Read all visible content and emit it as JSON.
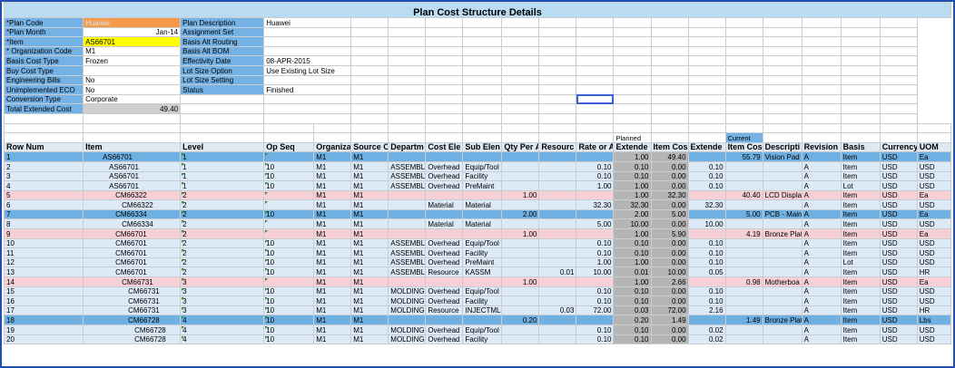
{
  "title": "Plan Cost Structure Details",
  "left_fields": [
    {
      "label": "*Plan Code",
      "value": "Huawei",
      "style": "orange"
    },
    {
      "label": "*Plan Month",
      "value": "Jan-14",
      "style": "right"
    },
    {
      "label": "*Item",
      "value": "AS66701",
      "style": "yellow"
    },
    {
      "label": "* Organization Code",
      "value": "M1",
      "style": "plain"
    },
    {
      "label": "Basis Cost Type",
      "value": "Frozen",
      "style": "plain"
    },
    {
      "label": "Buy Cost Type",
      "value": "",
      "style": "plain"
    },
    {
      "label": "Engineering Bills",
      "value": "No",
      "style": "plain"
    },
    {
      "label": "Unimplemented ECO",
      "value": "No",
      "style": "plain"
    },
    {
      "label": "Conversion Type",
      "value": "Corporate",
      "style": "plain"
    },
    {
      "label": "Total Extended Cost",
      "value": "49.40",
      "style": "gray"
    }
  ],
  "right_fields": [
    {
      "label": "Plan Description",
      "value": "Huawei"
    },
    {
      "label": "Assignment Set",
      "value": ""
    },
    {
      "label": "Basis Alt Routing",
      "value": ""
    },
    {
      "label": "Basis Alt BOM",
      "value": ""
    },
    {
      "label": "Effectivity Date",
      "value": "08-APR-2015"
    },
    {
      "label": "Lot Size Option",
      "value": "Use Existing Lot Size"
    },
    {
      "label": "Lot Size Setting",
      "value": ""
    },
    {
      "label": "Status",
      "value": "Finished"
    }
  ],
  "group_labels": {
    "planned": "Planned",
    "current": "Current"
  },
  "columns": [
    "Row Num",
    "Item",
    "Level",
    "Op Seq",
    "Organiza",
    "Source C",
    "Departm",
    "Cost Ele",
    "Sub Elen",
    "Qty Per A",
    "Resourc",
    "Rate or A",
    "Extende",
    "Item Cos",
    "Extende",
    "Item Cos",
    "Descripti",
    "Revision",
    "Basis",
    "Currency",
    "UOM"
  ],
  "rows": [
    {
      "type": "dblue",
      "c": [
        "1",
        "AS66701",
        "1",
        "",
        "M1",
        "M1",
        "",
        "",
        "",
        "",
        "",
        "",
        "1.00",
        "49.40",
        "",
        "55.79",
        "Vision Pad",
        "A",
        "Item",
        "USD",
        "Ea"
      ],
      "ind": 3
    },
    {
      "type": "lblue",
      "c": [
        "2",
        "AS66701",
        "1",
        "10",
        "M1",
        "M1",
        "ASSEMBLY",
        "Overhead",
        "Equip/Tool",
        "",
        "",
        "0.10",
        "0.10",
        "0.00",
        "0.10",
        "",
        "",
        "A",
        "Item",
        "USD",
        "USD"
      ],
      "ind": 4
    },
    {
      "type": "lblue",
      "c": [
        "3",
        "AS66701",
        "1",
        "10",
        "M1",
        "M1",
        "ASSEMBLY",
        "Overhead",
        "Facility",
        "",
        "",
        "0.10",
        "0.10",
        "0.00",
        "0.10",
        "",
        "",
        "A",
        "Item",
        "USD",
        "USD"
      ],
      "ind": 4
    },
    {
      "type": "lblue",
      "c": [
        "4",
        "AS66701",
        "1",
        "10",
        "M1",
        "M1",
        "ASSEMBLY",
        "Overhead",
        "PreMaint",
        "",
        "",
        "1.00",
        "1.00",
        "0.00",
        "0.10",
        "",
        "",
        "A",
        "Lot",
        "USD",
        "USD"
      ],
      "ind": 4
    },
    {
      "type": "pink",
      "c": [
        "5",
        "CM66322",
        "2",
        "",
        "M1",
        "M1",
        "",
        "",
        "",
        "1.00",
        "",
        "",
        "1.00",
        "32.30",
        "",
        "40.40",
        "LCD Display",
        "A",
        "Item",
        "USD",
        "Ea"
      ],
      "ind": 5
    },
    {
      "type": "lblue",
      "c": [
        "6",
        "CM66322",
        "2",
        "",
        "M1",
        "M1",
        "",
        "Material",
        "Material",
        "",
        "",
        "32.30",
        "32.30",
        "0.00",
        "32.30",
        "",
        "",
        "A",
        "Item",
        "USD",
        "USD"
      ],
      "ind": 6
    },
    {
      "type": "dblue",
      "c": [
        "7",
        "CM66334",
        "2",
        "10",
        "M1",
        "M1",
        "",
        "",
        "",
        "2.00",
        "",
        "",
        "2.00",
        "5.00",
        "",
        "5.00",
        "PCB - Main",
        "A",
        "Item",
        "USD",
        "Ea"
      ],
      "ind": 5
    },
    {
      "type": "lblue",
      "c": [
        "8",
        "CM66334",
        "2",
        "",
        "M1",
        "M1",
        "",
        "Material",
        "Material",
        "",
        "",
        "5.00",
        "10.00",
        "0.00",
        "10.00",
        "",
        "",
        "A",
        "Item",
        "USD",
        "USD"
      ],
      "ind": 6
    },
    {
      "type": "pink",
      "c": [
        "9",
        "CM66701",
        "2",
        "",
        "M1",
        "M1",
        "",
        "",
        "",
        "1.00",
        "",
        "",
        "1.00",
        "5.90",
        "",
        "4.19",
        "Bronze Plat",
        "A",
        "Item",
        "USD",
        "Ea"
      ],
      "ind": 5
    },
    {
      "type": "lblue",
      "c": [
        "10",
        "CM66701",
        "2",
        "10",
        "M1",
        "M1",
        "ASSEMBLY",
        "Overhead",
        "Equip/Tool",
        "",
        "",
        "0.10",
        "0.10",
        "0.00",
        "0.10",
        "",
        "",
        "A",
        "Item",
        "USD",
        "USD"
      ],
      "ind": 5
    },
    {
      "type": "lblue",
      "c": [
        "11",
        "CM66701",
        "2",
        "10",
        "M1",
        "M1",
        "ASSEMBLY",
        "Overhead",
        "Facility",
        "",
        "",
        "0.10",
        "0.10",
        "0.00",
        "0.10",
        "",
        "",
        "A",
        "Item",
        "USD",
        "USD"
      ],
      "ind": 5
    },
    {
      "type": "lblue",
      "c": [
        "12",
        "CM66701",
        "2",
        "10",
        "M1",
        "M1",
        "ASSEMBLY",
        "Overhead",
        "PreMaint",
        "",
        "",
        "1.00",
        "1.00",
        "0.00",
        "0.10",
        "",
        "",
        "A",
        "Lot",
        "USD",
        "USD"
      ],
      "ind": 5
    },
    {
      "type": "lblue",
      "c": [
        "13",
        "CM66701",
        "2",
        "10",
        "M1",
        "M1",
        "ASSEMBLY",
        "Resource",
        "KASSM",
        "",
        "0.01",
        "10.00",
        "0.01",
        "10.00",
        "0.05",
        "",
        "",
        "A",
        "Item",
        "USD",
        "HR"
      ],
      "ind": 5
    },
    {
      "type": "pink",
      "c": [
        "14",
        "CM66731",
        "3",
        "",
        "M1",
        "M1",
        "",
        "",
        "",
        "1.00",
        "",
        "",
        "1.00",
        "2.66",
        "",
        "0.98",
        "Motherboa",
        "A",
        "Item",
        "USD",
        "Ea"
      ],
      "ind": 6
    },
    {
      "type": "lblue",
      "c": [
        "15",
        "CM66731",
        "3",
        "10",
        "M1",
        "M1",
        "MOLDING",
        "Overhead",
        "Equip/Tool",
        "",
        "",
        "0.10",
        "0.10",
        "0.00",
        "0.10",
        "",
        "",
        "A",
        "Item",
        "USD",
        "USD"
      ],
      "ind": 7
    },
    {
      "type": "lblue",
      "c": [
        "16",
        "CM66731",
        "3",
        "10",
        "M1",
        "M1",
        "MOLDING",
        "Overhead",
        "Facility",
        "",
        "",
        "0.10",
        "0.10",
        "0.00",
        "0.10",
        "",
        "",
        "A",
        "Item",
        "USD",
        "USD"
      ],
      "ind": 7
    },
    {
      "type": "lblue",
      "c": [
        "17",
        "CM66731",
        "3",
        "10",
        "M1",
        "M1",
        "MOLDING",
        "Resource",
        "INJECTMLD3",
        "",
        "0.03",
        "72.00",
        "0.03",
        "72.00",
        "2.16",
        "",
        "",
        "A",
        "Item",
        "USD",
        "HR"
      ],
      "ind": 7
    },
    {
      "type": "dblue",
      "c": [
        "18",
        "CM66728",
        "4",
        "10",
        "M1",
        "M1",
        "",
        "",
        "",
        "0.20",
        "",
        "",
        "0.20",
        "1.49",
        "",
        "1.49",
        "Bronze Plat",
        "A",
        "Item",
        "USD",
        "Lbs"
      ],
      "ind": 7
    },
    {
      "type": "lblue",
      "c": [
        "19",
        "CM66728",
        "4",
        "10",
        "M1",
        "M1",
        "MOLDING",
        "Overhead",
        "Equip/Tool",
        "",
        "",
        "0.10",
        "0.10",
        "0.00",
        "0.02",
        "",
        "",
        "A",
        "Item",
        "USD",
        "USD"
      ],
      "ind": 8
    },
    {
      "type": "lblue",
      "c": [
        "20",
        "CM66728",
        "4",
        "10",
        "M1",
        "M1",
        "MOLDING",
        "Overhead",
        "Facility",
        "",
        "",
        "0.10",
        "0.10",
        "0.00",
        "0.02",
        "",
        "",
        "A",
        "Item",
        "USD",
        "USD"
      ],
      "ind": 8
    }
  ]
}
